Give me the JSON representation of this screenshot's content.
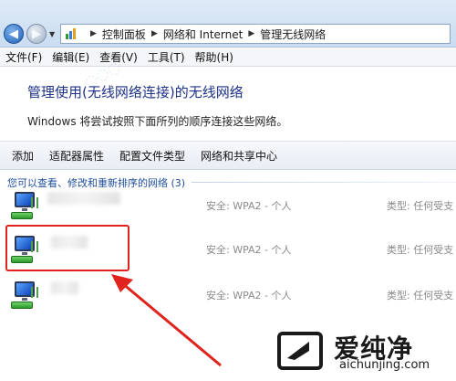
{
  "address_bar": {
    "breadcrumb": [
      "控制面板",
      "网络和 Internet",
      "管理无线网络"
    ]
  },
  "menu": {
    "items": [
      "文件(F)",
      "编辑(E)",
      "查看(V)",
      "工具(T)",
      "帮助(H)"
    ]
  },
  "header": {
    "title": "管理使用(无线网络连接)的无线网络",
    "description": "Windows 将尝试按照下面所列的顺序连接这些网络。"
  },
  "toolbar": {
    "buttons": [
      "添加",
      "适配器属性",
      "配置文件类型",
      "网络和共享中心"
    ]
  },
  "network_list": {
    "group_header": "您可以查看、修改和重新排序的网络 (3)",
    "networks": [
      {
        "security": "安全: WPA2 - 个人",
        "type": "类型: 任何受支"
      },
      {
        "security": "安全: WPA2 - 个人",
        "type": "类型: 任何受支"
      },
      {
        "security": "安全: WPA2 - 个人",
        "type": "类型: 任何受支"
      }
    ]
  },
  "watermark": {
    "brand": "爱纯净",
    "url": "aichunjing.com"
  },
  "colors": {
    "title_blue": "#1e3287",
    "group_blue": "#1e4e9c",
    "annotation_red": "#e0231c"
  }
}
